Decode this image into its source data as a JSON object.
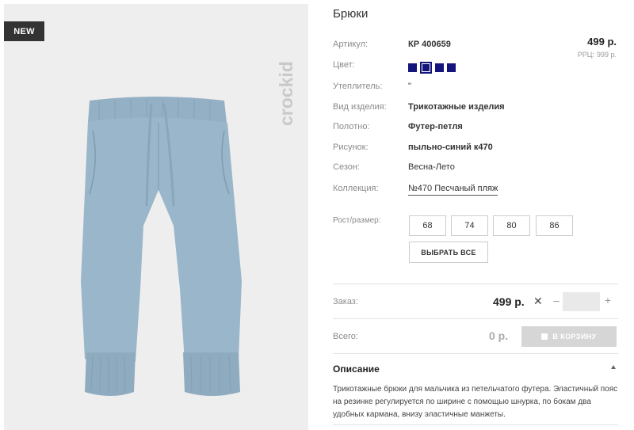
{
  "badge": "NEW",
  "brand": "crockid",
  "product": {
    "title": "Брюки",
    "price": "499 р.",
    "rrp_label": "РРЦ:",
    "rrp_value": "999 р."
  },
  "attributes": {
    "article_label": "Артикул:",
    "article_value": "КР 400659",
    "color_label": "Цвет:",
    "insulation_label": "Утеплитель:",
    "insulation_value": "\"",
    "type_label": "Вид изделия:",
    "type_value": "Трикотажные изделия",
    "fabric_label": "Полотно:",
    "fabric_value": "Футер-петля",
    "pattern_label": "Рисунок:",
    "pattern_value": "пыльно-синий к470",
    "season_label": "Сезон:",
    "season_value": "Весна-Лето",
    "collection_label": "Коллекция:",
    "collection_value": "№470 Песчаный пляж"
  },
  "colors": {
    "swatch": "#13157a",
    "count": 4,
    "selected_index": 1
  },
  "sizes": {
    "label": "Рост/размер:",
    "options": [
      "68",
      "74",
      "80",
      "86"
    ],
    "select_all": "ВЫБРАТЬ ВСЕ"
  },
  "order": {
    "label": "Заказ:",
    "price": "499 р.",
    "times": "✕",
    "minus": "–",
    "plus": "+",
    "quantity": ""
  },
  "total": {
    "label": "Всего:",
    "value": "0 р.",
    "cart_button": "В КОРЗИНУ"
  },
  "description": {
    "title": "Описание",
    "text": "Трикотажные брюки для мальчика из петельчатого футера. Эластичный пояс на резинке регулируется по ширине с помощью шнурка, по бокам два удобных кармана, внизу эластичные манжеты."
  }
}
